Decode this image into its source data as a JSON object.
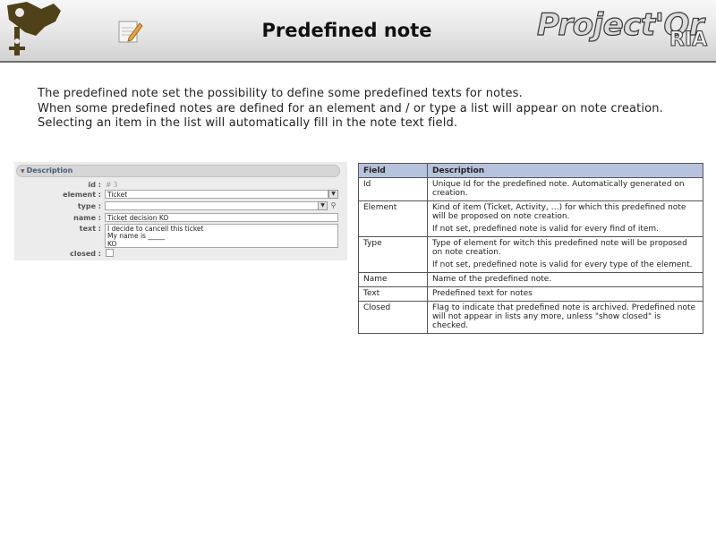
{
  "header": {
    "title": "Predefined note",
    "brand": "Project'Or",
    "brand_sub": "RIA"
  },
  "intro": {
    "lines": [
      "The predefined note set the possibility to define some predefined texts for notes.",
      "When some predefined notes are defined for an element and / or type a list will appear on note creation.",
      "Selecting an item in the list will automatically fill in the note text field."
    ]
  },
  "form": {
    "section_title": "Description",
    "id_label": "id :",
    "id_value": "# 3",
    "element_label": "element :",
    "element_value": "Ticket",
    "type_label": "type :",
    "type_value": "",
    "name_label": "name :",
    "name_value": "Ticket decision KO",
    "text_label": "text :",
    "text_lines": [
      "I decide to cancell this ticket",
      "My name is _____",
      "KO"
    ],
    "closed_label": "closed :"
  },
  "table": {
    "headers": [
      "Field",
      "Description"
    ],
    "rows": [
      {
        "field": "Id",
        "desc": [
          "Unique Id for the predefined note. Automatically generated on creation."
        ]
      },
      {
        "field": "Element",
        "desc": [
          "Kind of item (Ticket, Activity, …) for which this predefined note will be proposed on note creation.",
          "If not set, predefined note is valid for every find of item."
        ]
      },
      {
        "field": "Type",
        "desc": [
          "Type of element for witch this predefined note will be proposed on note creation.",
          "If not set, predefined note is valid for every type of the element."
        ]
      },
      {
        "field": "Name",
        "desc": [
          "Name of the predefined note."
        ]
      },
      {
        "field": "Text",
        "desc": [
          "Predefined text for notes"
        ]
      },
      {
        "field": "Closed",
        "desc": [
          "Flag to indicate that predefined note is archived. Predefined note will not appear in lists any more, unless \"show closed\" is checked."
        ]
      }
    ]
  },
  "colors": {
    "table_header_bg": "#b7c2dc",
    "section_title_color": "#4a5a7a",
    "logo_color": "#5a4a1e"
  },
  "icons": [
    "projector-logo-icon",
    "note-pad-icon",
    "dropdown-arrow-icon",
    "search-icon",
    "collapse-triangle-icon"
  ]
}
